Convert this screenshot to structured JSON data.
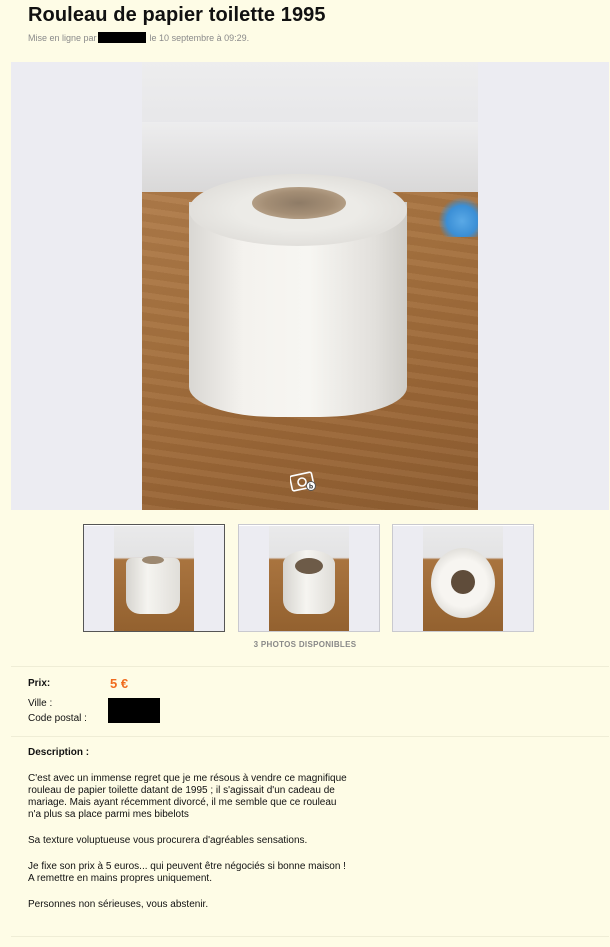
{
  "listing": {
    "title": "Rouleau de papier toilette 1995",
    "posted_prefix": "Mise en ligne par",
    "posted_suffix": "le 10 septembre à 09:29."
  },
  "photos": {
    "count_label": "3 PHOTOS DISPONIBLES",
    "camera_icon": "camera-icon"
  },
  "details": {
    "price_label": "Prix:",
    "price_value": "5 €",
    "city_label": "Ville :",
    "postal_label": "Code postal :"
  },
  "description": {
    "heading": "Description :",
    "p1_l1": "C'est avec un immense regret que je me résous à vendre ce magnifique",
    "p1_l2": "rouleau de papier toilette datant de 1995 ; il s'agissait d'un cadeau de",
    "p1_l3": "mariage. Mais ayant récemment divorcé, il me semble que ce rouleau",
    "p1_l4": "n'a plus sa place parmi mes bibelots",
    "p2": "Sa texture voluptueuse vous procurera d'agréables sensations.",
    "p3_l1": "Je fixe son prix à 5 euros... qui peuvent être négociés si bonne maison !",
    "p3_l2": "A remettre en mains propres uniquement.",
    "p4": "Personnes non sérieuses, vous abstenir."
  },
  "colors": {
    "page_background": "#fefce6",
    "price_accent": "#f06b1e"
  }
}
